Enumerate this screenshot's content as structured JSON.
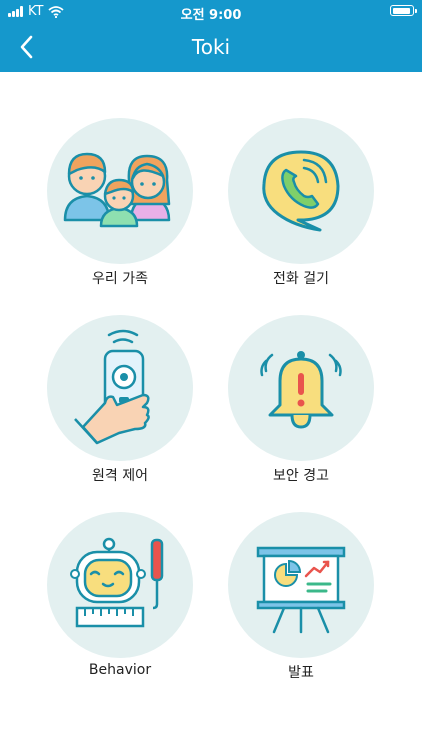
{
  "status_bar": {
    "carrier": "KT",
    "time": "오전 9:00"
  },
  "header": {
    "title": "Toki"
  },
  "menu": [
    {
      "label": "우리 가족",
      "icon": "family-icon"
    },
    {
      "label": "전화 걸기",
      "icon": "phone-call-icon"
    },
    {
      "label": "원격 제어",
      "icon": "remote-control-icon"
    },
    {
      "label": "보안 경고",
      "icon": "alarm-bell-icon"
    },
    {
      "label": "Behavior",
      "icon": "robot-ruler-icon"
    },
    {
      "label": "발표",
      "icon": "presentation-board-icon"
    }
  ],
  "colors": {
    "accent": "#1598cc",
    "circle_bg": "#e3f0f0",
    "outline": "#1a8fa8",
    "yellow": "#f8de7e"
  }
}
